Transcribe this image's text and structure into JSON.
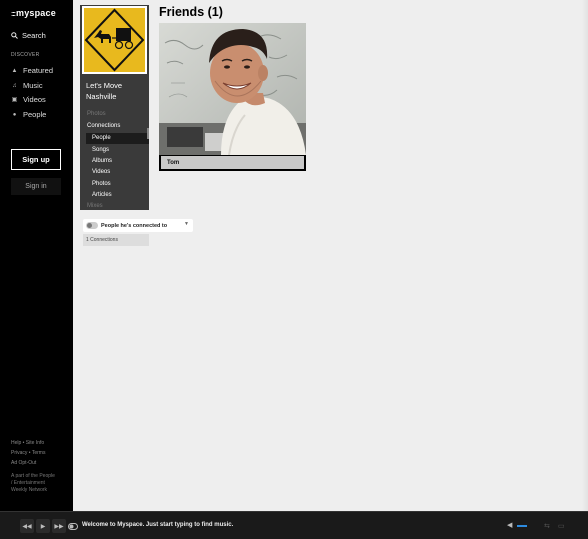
{
  "nav": {
    "logo": "myspace",
    "search": "Search",
    "discover": "DISCOVER",
    "items": [
      {
        "label": "Featured",
        "icon": "flame-icon"
      },
      {
        "label": "Music",
        "icon": "music-note-icon"
      },
      {
        "label": "Videos",
        "icon": "video-icon"
      },
      {
        "label": "People",
        "icon": "people-icon"
      }
    ],
    "signup": "Sign up",
    "signin": "Sign in",
    "footer_links": [
      "Help • Site Info",
      "Privacy • Terms",
      "Ad Opt-Out"
    ],
    "about": "A part of the People / Entertainment Weekly Network"
  },
  "profile": {
    "name": "Let's Move Nashville",
    "menu": {
      "photos": "Photos",
      "connections": "Connections",
      "people": "People",
      "songs": "Songs",
      "albums": "Albums",
      "videos": "Videos",
      "photos2": "Photos",
      "articles": "Articles",
      "mixes": "Mixes"
    },
    "sign_color": "#e8b91e"
  },
  "connections": {
    "dropdown_label": "People he's connected to",
    "count": "1 Connections"
  },
  "main": {
    "title": "Friends (1)",
    "friends": [
      {
        "name": "Tom"
      }
    ]
  },
  "player": {
    "message": "Welcome to Myspace. Just start typing to find music.",
    "accent": "#2d8bdf"
  }
}
